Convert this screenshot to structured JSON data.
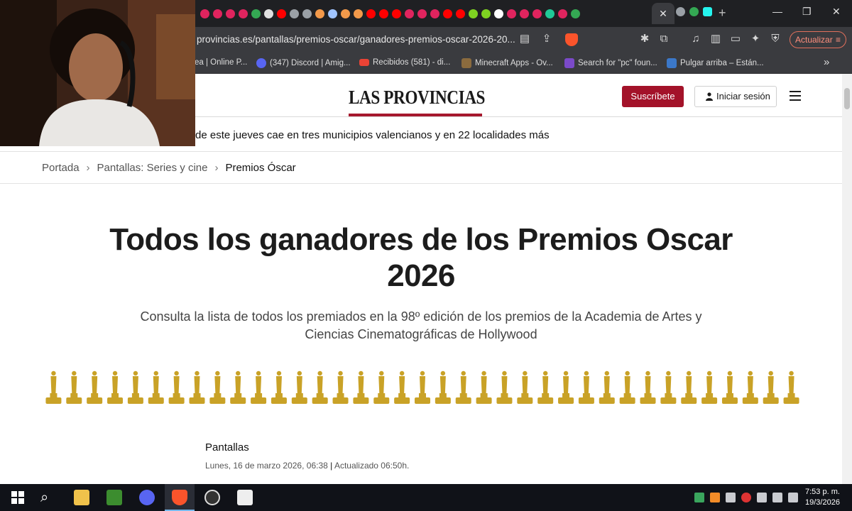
{
  "browser": {
    "url": "provincias.es/pantallas/premios-oscar/ganadores-premios-oscar-2026-20...",
    "update_label": "Actualizar",
    "active_tab_close": "✕",
    "new_tab": "+",
    "bookmarks": [
      {
        "label": "ea | Online P...",
        "icon_color": "#4a8ae0"
      },
      {
        "label": "(347) Discord | Amig...",
        "icon_color": "#5865f2"
      },
      {
        "label": "Recibidos (581) - di...",
        "icon_color": "#ea4335"
      },
      {
        "label": "Minecraft Apps - Ov...",
        "icon_color": "#8b6b3e"
      },
      {
        "label": "Search for \"pc\" foun...",
        "icon_color": "#7b4ac9"
      },
      {
        "label": "Pulgar arriba – Están...",
        "icon_color": "#3b78c9"
      }
    ],
    "bookmarks_more": "»"
  },
  "site": {
    "logo": "LAS PROVINCIAS",
    "subscribe_label": "Suscríbete",
    "login_label": "Iniciar sesión",
    "ticker": "de este jueves cae en tres municipios valencianos y en 22 localidades más"
  },
  "breadcrumb": {
    "items": [
      "Portada",
      "Pantallas: Series y cine",
      "Premios Óscar"
    ],
    "separator": "›"
  },
  "article": {
    "headline": "Todos los ganadores de los Premios Oscar 2026",
    "subheadline": "Consulta la lista de todos los premiados en la 98º edición de los premios de la Academia de Artes y Ciencias Cinematográficas de Hollywood",
    "oscar_statuette_count": 37,
    "statuette_color": "#c9a227",
    "section": "Pantallas",
    "date": "Lunes, 16 de marzo 2026, 06:38",
    "updated": "Actualizado 06:50h."
  },
  "taskbar": {
    "time": "7:53 p. m.",
    "date": "19/3/2026"
  },
  "colors": {
    "brand_red": "#a31229",
    "accent_underline": "#a6182d",
    "chrome_dark": "#1f2023",
    "chrome_mid": "#3a3b3f"
  }
}
